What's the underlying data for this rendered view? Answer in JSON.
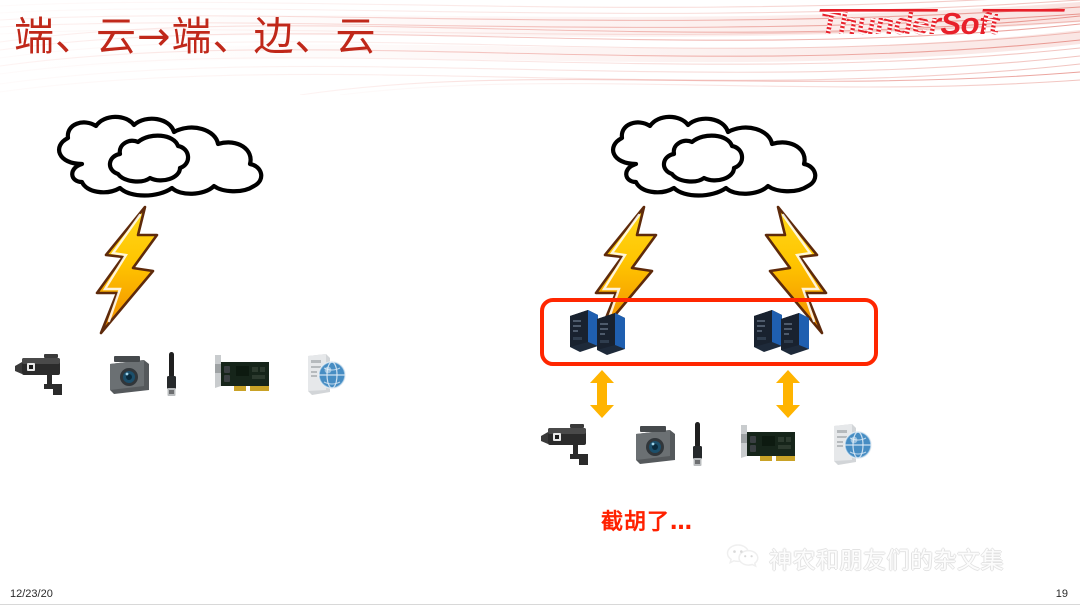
{
  "slide": {
    "title": "端、云→端、边、云",
    "title_color": "#C0281A",
    "background": "#ffffff"
  },
  "logo": {
    "name": "ThunderSoft",
    "part_a": "Thunder",
    "part_b": "Soft",
    "color": "#E8202A"
  },
  "diagram": {
    "left_group": {
      "cloud_label": "cloud",
      "lightning_count": 1,
      "devices": [
        {
          "name": "cctv-camera",
          "label": "CCTV Camera"
        },
        {
          "name": "dashcam-usb",
          "label": "Dashcam with USB cable"
        },
        {
          "name": "pcie-card",
          "label": "PCIe Accelerator Card"
        },
        {
          "name": "pc-tower-globe",
          "label": "Server / Network PC"
        }
      ]
    },
    "right_group": {
      "cloud_label": "cloud",
      "lightning_count": 2,
      "edge_box": {
        "border_color": "#FF2600",
        "server_pairs": 2,
        "label": "Edge nodes"
      },
      "arrows": {
        "color": "#FFB400",
        "count": 2,
        "direction": "bidirectional"
      },
      "devices": [
        {
          "name": "cctv-camera",
          "label": "CCTV Camera"
        },
        {
          "name": "dashcam-usb",
          "label": "Dashcam with USB cable"
        },
        {
          "name": "pcie-card",
          "label": "PCIe Accelerator Card"
        },
        {
          "name": "pc-tower-globe",
          "label": "Server / Network PC"
        }
      ]
    }
  },
  "caption": {
    "text": "截胡了…",
    "color": "#FF2100"
  },
  "watermark": {
    "text": "神农和朋友们的杂文集",
    "icon": "wechat-icon"
  },
  "footer": {
    "date": "12/23/20",
    "page_number": "19"
  }
}
